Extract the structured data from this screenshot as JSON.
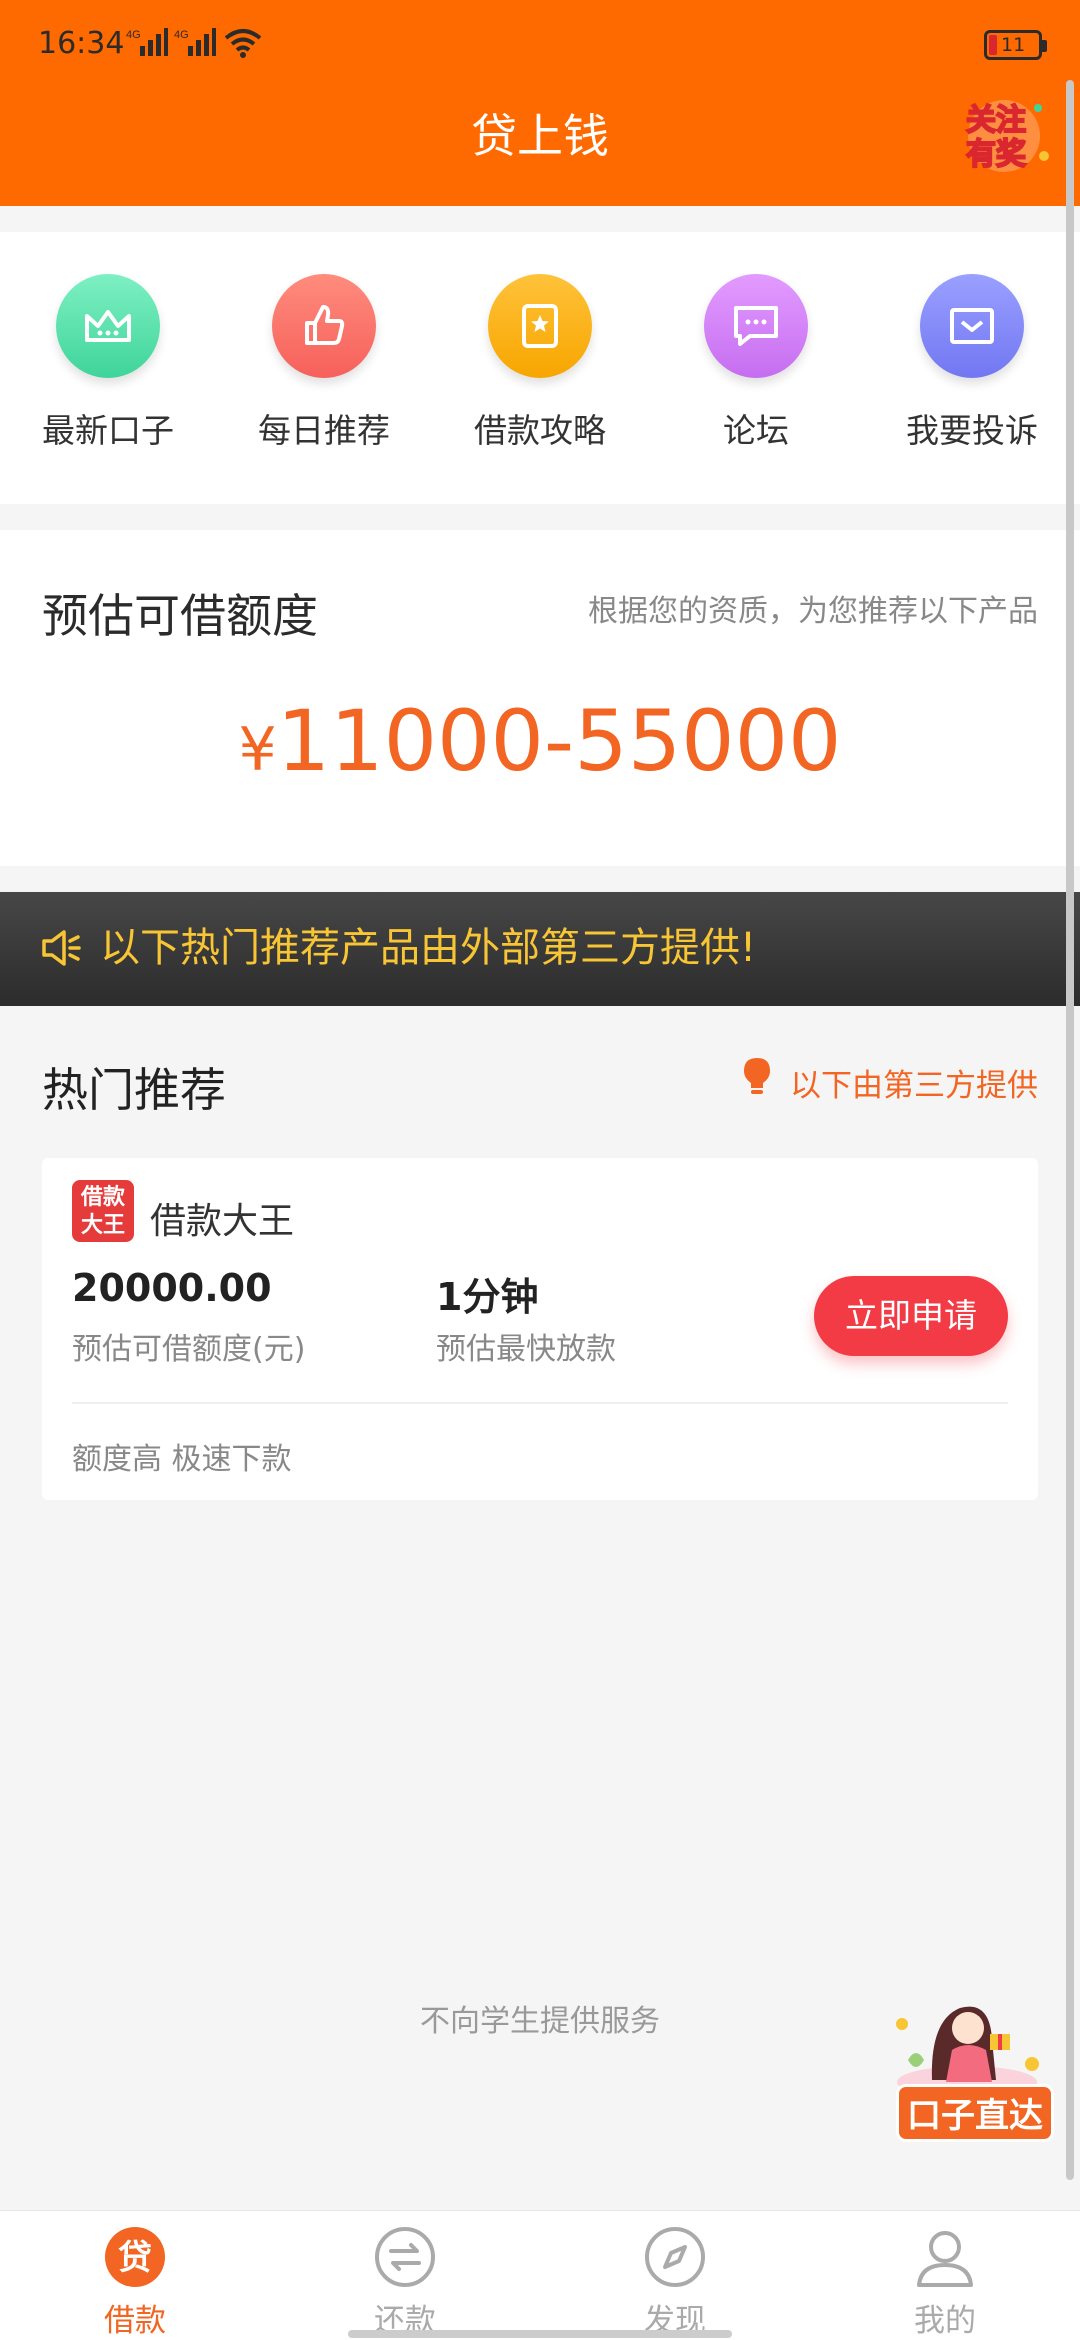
{
  "status_bar": {
    "time": "16:34",
    "network_1": "4G",
    "network_2": "4G",
    "battery": "11"
  },
  "header": {
    "title": "贷上钱",
    "badge": "关注有奖"
  },
  "quick_nav": [
    {
      "label": "最新口子",
      "icon": "crown-icon",
      "color": "#3fd49a"
    },
    {
      "label": "每日推荐",
      "icon": "thumbs-up-icon",
      "color": "#f6605b"
    },
    {
      "label": "借款攻略",
      "icon": "guide-book-icon",
      "color": "#f7a600"
    },
    {
      "label": "论坛",
      "icon": "chat-bubble-icon",
      "color": "#c56ef0"
    },
    {
      "label": "我要投诉",
      "icon": "mail-icon",
      "color": "#7277f2"
    }
  ],
  "quota": {
    "title": "预估可借额度",
    "subtitle": "根据您的资质，为您推荐以下产品",
    "currency": "¥",
    "range": "11000-55000"
  },
  "notice": {
    "text": "以下热门推荐产品由外部第三方提供!"
  },
  "hot": {
    "title": "热门推荐",
    "hint": "以下由第三方提供"
  },
  "product": {
    "logo_text": "借款大王",
    "name": "借款大王",
    "limit": "20000.00",
    "limit_label": "预估可借额度(元)",
    "speed": "1分钟",
    "speed_label": "预估最快放款",
    "apply": "立即申请",
    "tags": "额度高 极速下款"
  },
  "footer_note": "不向学生提供服务",
  "promo": {
    "label": "口子直达"
  },
  "tabs": [
    {
      "label": "借款",
      "icon": "loan-icon",
      "active": true
    },
    {
      "label": "还款",
      "icon": "repay-icon",
      "active": false
    },
    {
      "label": "发现",
      "icon": "compass-icon",
      "active": false
    },
    {
      "label": "我的",
      "icon": "profile-icon",
      "active": false
    }
  ],
  "colors": {
    "brand": "#ff6a00",
    "accent": "#f26522",
    "apply_button": "#f23b45",
    "notice_text": "#f8c534"
  }
}
